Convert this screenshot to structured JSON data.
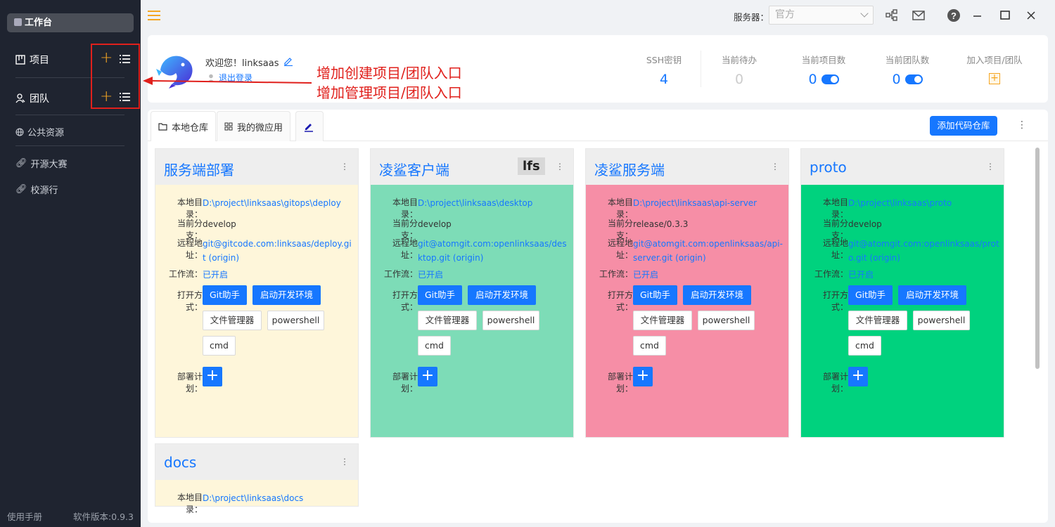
{
  "sidebar": {
    "workspace": "工作台",
    "project": "项目",
    "team": "团队",
    "public": "公共资源",
    "contest": "开源大赛",
    "campus": "校源行",
    "manual": "使用手册",
    "version": "软件版本:0.9.3"
  },
  "topbar": {
    "server_label": "服务器：",
    "server_value": "官方"
  },
  "header": {
    "welcome": "欢迎您！linksaas",
    "logout": "退出登录",
    "stats": [
      {
        "label": "SSH密钥",
        "value": "4"
      },
      {
        "label": "当前待办",
        "value": "0"
      },
      {
        "label": "当前项目数",
        "value": "0"
      },
      {
        "label": "当前团队数",
        "value": "0"
      },
      {
        "label": "加入项目/团队",
        "value": "+"
      }
    ]
  },
  "annotations": {
    "line1": "增加创建项目/团队入口",
    "line2": "增加管理项目/团队入口",
    "color": "#e0201c"
  },
  "tabs": {
    "local_repo": "本地仓库",
    "micro_app": "我的微应用",
    "add_repo": "添加代码仓库"
  },
  "labels": {
    "local_dir": "本地目录：",
    "branch": "当前分支：",
    "remote": "远程地址：",
    "workflow": "工作流：",
    "open_with": "打开方式：",
    "deploy": "部署计划：",
    "git_helper": "Git助手",
    "start_env": "启动开发环境",
    "file_mgr": "文件管理器",
    "powershell": "powershell",
    "cmd": "cmd"
  },
  "cards": [
    {
      "title": "服务端部署",
      "dir": "D:\\project\\linksaas\\gitops\\deploy",
      "branch": "develop",
      "remote": "git@gitcode.com:linksaas/deploy.git (origin)",
      "workflow": "已开启",
      "bg": "#fef6da"
    },
    {
      "title": "凌鲨客户端",
      "badge": "lfs",
      "dir": "D:\\project\\linksaas\\desktop",
      "branch": "develop",
      "remote": "git@atomgit.com:openlinksaas/desktop.git (origin)",
      "workflow": "已开启",
      "bg": "#7ddcb7"
    },
    {
      "title": "凌鲨服务端",
      "dir": "D:\\project\\linksaas\\api-server",
      "branch": "release/0.3.3",
      "remote": "git@atomgit.com:openlinksaas/api-server.git (origin)",
      "workflow": "已开启",
      "bg": "#f68ea6"
    },
    {
      "title": "proto",
      "dir": "D:\\project\\linksaas\\proto",
      "branch": "develop",
      "remote": "git@atomgit.com:openlinksaas/proto.git (origin)",
      "workflow": "已开启",
      "bg": "#00d27e"
    },
    {
      "title": "docs",
      "dir": "D:\\project\\linksaas\\docs",
      "bg": "#fef6da"
    }
  ]
}
